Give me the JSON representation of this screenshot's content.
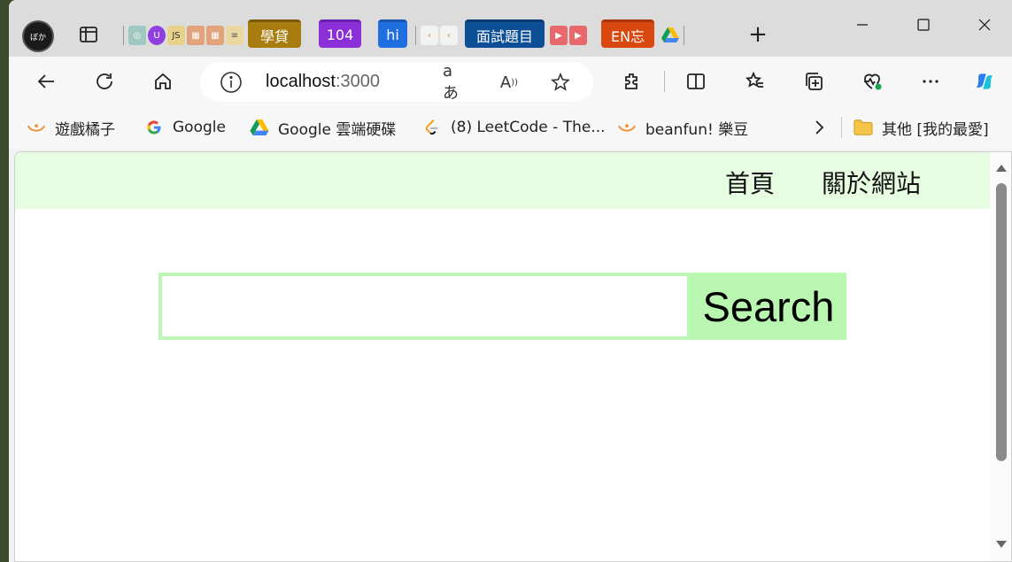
{
  "browser": {
    "profile_label": "ぼか",
    "tabs": {
      "js_label": "JS",
      "loan_label": "學貸",
      "job104_label": "104",
      "hi_label": "hi",
      "interview_label": "面試題目",
      "en_label": "EN忘"
    },
    "address": {
      "host": "localhost",
      "port": ":3000",
      "translate_label": "aあ",
      "read_aloud_label": "A"
    },
    "bookmarks": [
      {
        "label": "遊戲橘子"
      },
      {
        "label": "Google"
      },
      {
        "label": "Google 雲端硬碟"
      },
      {
        "label": "(8) LeetCode - The..."
      },
      {
        "label": "beanfun! 樂豆"
      }
    ],
    "other_bookmarks_label": "其他 [我的最愛]"
  },
  "page": {
    "nav": {
      "home_label": "首頁",
      "about_label": "關於網站"
    },
    "search": {
      "value": "",
      "button_label": "Search"
    }
  },
  "colors": {
    "navbar_bg": "#e6fde1",
    "search_accent": "#b9f7b0",
    "loan_tab": "#a87d0e",
    "job104_tab": "#8b2fd8",
    "hi_tab": "#1f6fe0",
    "interview_tab": "#0d4f96",
    "en_tab": "#d9480f"
  }
}
